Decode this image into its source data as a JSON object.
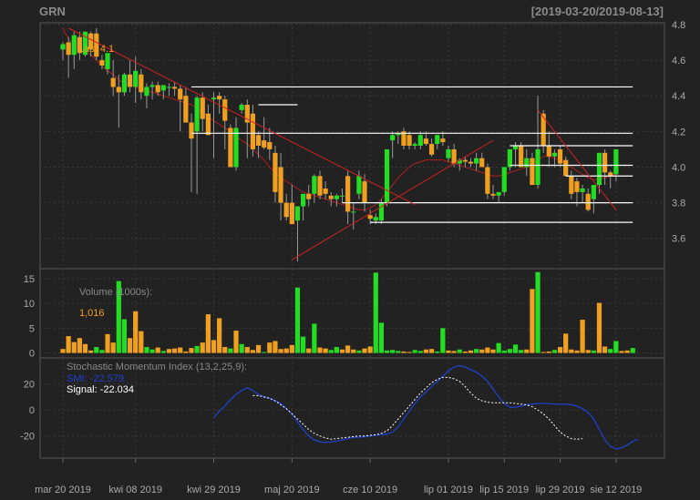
{
  "header": {
    "ticker": "GRN",
    "date_range": "[2019-03-20/2019-08-13]"
  },
  "price_panel": {
    "last_label": "Last 4.1"
  },
  "volume_panel": {
    "title": "Volume (1000s):",
    "last_value": "1,016"
  },
  "smi_panel": {
    "title": "Stochastic Momentum Index (13,2,25,9):",
    "smi_label": "SMI: -22.579",
    "signal_label": "Signal: -22.034"
  },
  "colors": {
    "background": "#222222",
    "grid": "#3a3a3a",
    "up": "#22dd22",
    "down": "#f0a020",
    "trendline": "#d42020",
    "level": "#ffffff",
    "smi": "#2040cc",
    "signal": "#ffffff",
    "axis_text": "#aaaaaa",
    "volume_title": "#888888",
    "volume_value": "#f0a020"
  },
  "chart_data": [
    {
      "type": "candlestick",
      "ticker": "GRN",
      "y_ticks": [
        3.6,
        3.8,
        4.0,
        4.2,
        4.4,
        4.6,
        4.8
      ],
      "ylim": [
        3.43,
        4.81
      ],
      "x_tick_labels": [
        "mar 20 2019",
        "kwi 08 2019",
        "kwi 29 2019",
        "maj 20 2019",
        "cze 10 2019",
        "lip 01 2019",
        "lip 15 2019",
        "lip 29 2019",
        "sie 12 2019"
      ],
      "x_tick_index": [
        0,
        13,
        27,
        41,
        55,
        69,
        79,
        89,
        99
      ],
      "candles": [
        [
          4.66,
          4.7,
          4.6,
          4.69
        ],
        [
          4.7,
          4.73,
          4.5,
          4.63
        ],
        [
          4.63,
          4.76,
          4.55,
          4.74
        ],
        [
          4.73,
          4.76,
          4.6,
          4.64
        ],
        [
          4.63,
          4.76,
          4.62,
          4.76
        ],
        [
          4.75,
          4.76,
          4.62,
          4.66
        ],
        [
          4.75,
          4.78,
          4.6,
          4.62
        ],
        [
          4.6,
          4.63,
          4.55,
          4.57
        ],
        [
          4.55,
          4.63,
          4.52,
          4.64
        ],
        [
          4.5,
          4.6,
          4.4,
          4.45
        ],
        [
          4.45,
          4.52,
          4.22,
          4.42
        ],
        [
          4.42,
          4.53,
          4.4,
          4.52
        ],
        [
          4.52,
          4.6,
          4.42,
          4.45
        ],
        [
          4.45,
          4.62,
          4.36,
          4.54
        ],
        [
          4.52,
          4.55,
          4.38,
          4.42
        ],
        [
          4.4,
          4.47,
          4.33,
          4.45
        ],
        [
          4.45,
          4.48,
          4.38,
          4.46
        ],
        [
          4.46,
          4.48,
          4.4,
          4.42
        ],
        [
          4.43,
          4.45,
          4.38,
          4.46
        ],
        [
          4.45,
          4.47,
          4.4,
          4.45
        ],
        [
          4.45,
          4.48,
          4.4,
          4.44
        ],
        [
          4.44,
          4.46,
          4.2,
          4.38
        ],
        [
          4.4,
          4.45,
          4.3,
          4.25
        ],
        [
          4.25,
          4.3,
          3.86,
          4.16
        ],
        [
          4.2,
          4.4,
          3.85,
          4.39
        ],
        [
          4.39,
          4.42,
          4.2,
          4.27
        ],
        [
          4.3,
          4.35,
          4.18,
          4.18
        ],
        [
          4.38,
          4.42,
          4.05,
          4.39
        ],
        [
          4.4,
          4.42,
          4.3,
          4.38
        ],
        [
          4.38,
          4.4,
          4.1,
          4.26
        ],
        [
          4.22,
          4.24,
          4.0,
          4.0
        ],
        [
          4.0,
          4.28,
          3.98,
          4.22
        ],
        [
          4.32,
          4.36,
          4.3,
          4.35
        ],
        [
          4.35,
          4.38,
          4.05,
          4.25
        ],
        [
          4.3,
          4.35,
          4.06,
          4.1
        ],
        [
          4.18,
          4.2,
          4.05,
          4.12
        ],
        [
          4.15,
          4.28,
          4.1,
          4.11
        ],
        [
          4.14,
          4.22,
          4.04,
          4.1
        ],
        [
          4.08,
          4.12,
          3.8,
          3.86
        ],
        [
          4.0,
          4.08,
          3.7,
          3.8
        ],
        [
          3.8,
          3.85,
          3.7,
          3.72
        ],
        [
          3.8,
          3.9,
          3.7,
          3.68
        ],
        [
          3.7,
          3.78,
          3.47,
          3.78
        ],
        [
          3.78,
          3.82,
          3.7,
          3.85
        ],
        [
          3.85,
          3.9,
          3.78,
          3.82
        ],
        [
          3.85,
          3.96,
          3.8,
          3.95
        ],
        [
          3.95,
          3.98,
          3.82,
          3.84
        ],
        [
          3.88,
          3.92,
          3.82,
          3.85
        ],
        [
          3.84,
          3.86,
          3.78,
          3.82
        ],
        [
          3.82,
          3.85,
          3.78,
          3.84
        ],
        [
          3.84,
          3.88,
          3.8,
          3.84
        ],
        [
          3.95,
          3.98,
          3.68,
          3.75
        ],
        [
          3.75,
          3.8,
          3.65,
          3.75
        ],
        [
          3.85,
          3.98,
          3.82,
          3.95
        ],
        [
          3.92,
          3.96,
          3.75,
          3.8
        ],
        [
          3.73,
          3.76,
          3.68,
          3.71
        ],
        [
          3.7,
          3.74,
          3.68,
          3.72
        ],
        [
          3.7,
          3.82,
          3.68,
          3.8
        ],
        [
          3.8,
          4.1,
          3.78,
          4.1
        ],
        [
          4.15,
          4.2,
          4.05,
          4.18
        ],
        [
          4.18,
          4.2,
          4.13,
          4.19
        ],
        [
          4.2,
          4.22,
          4.1,
          4.12
        ],
        [
          4.18,
          4.2,
          4.1,
          4.12
        ],
        [
          4.12,
          4.14,
          4.1,
          4.13
        ],
        [
          4.12,
          4.2,
          4.1,
          4.18
        ],
        [
          4.16,
          4.2,
          4.12,
          4.13
        ],
        [
          4.13,
          4.16,
          4.06,
          4.07
        ],
        [
          4.13,
          4.18,
          4.1,
          4.18
        ],
        [
          4.16,
          4.2,
          4.12,
          4.14
        ],
        [
          4.05,
          4.12,
          4.03,
          4.1
        ],
        [
          4.1,
          4.13,
          4.0,
          4.02
        ],
        [
          4.02,
          4.05,
          3.98,
          4.04
        ],
        [
          4.04,
          4.06,
          4.0,
          4.03
        ],
        [
          4.03,
          4.05,
          4.0,
          4.02
        ],
        [
          4.02,
          4.08,
          3.98,
          4.05
        ],
        [
          4.05,
          4.08,
          4.0,
          4.0
        ],
        [
          4.0,
          4.02,
          3.82,
          3.85
        ],
        [
          3.85,
          3.9,
          3.82,
          3.84
        ],
        [
          3.84,
          3.86,
          3.8,
          3.86
        ],
        [
          3.86,
          3.96,
          3.84,
          4.0
        ],
        [
          4.0,
          4.04,
          3.98,
          4.1
        ],
        [
          4.1,
          4.14,
          4.0,
          4.12
        ],
        [
          4.12,
          4.14,
          4.0,
          4.0
        ],
        [
          4.0,
          4.1,
          3.95,
          4.05
        ],
        [
          4.05,
          4.08,
          3.92,
          3.9
        ],
        [
          3.9,
          4.4,
          3.88,
          4.1
        ],
        [
          4.3,
          4.32,
          4.08,
          4.12
        ],
        [
          4.12,
          4.2,
          4.0,
          4.06
        ],
        [
          4.06,
          4.1,
          4.0,
          4.08
        ],
        [
          4.1,
          4.12,
          4.0,
          4.02
        ],
        [
          4.04,
          4.06,
          3.95,
          3.95
        ],
        [
          3.95,
          3.98,
          3.82,
          3.85
        ],
        [
          3.92,
          3.94,
          3.78,
          3.86
        ],
        [
          3.86,
          3.9,
          3.8,
          3.88
        ],
        [
          3.85,
          3.88,
          3.75,
          3.76
        ],
        [
          3.82,
          3.9,
          3.74,
          3.9
        ],
        [
          3.9,
          4.08,
          3.85,
          4.08
        ],
        [
          4.08,
          4.1,
          3.9,
          3.97
        ],
        [
          3.97,
          3.98,
          3.88,
          3.95
        ],
        [
          3.96,
          4.1,
          3.92,
          4.1
        ]
      ],
      "moving_average": [
        4.78,
        4.72,
        4.69,
        4.67,
        4.65,
        4.63,
        4.6,
        4.57,
        4.54,
        4.52,
        4.49,
        4.47,
        4.46,
        4.45,
        4.44,
        4.43,
        4.42,
        4.41,
        4.4,
        4.39,
        4.38,
        4.37,
        4.36,
        4.35,
        4.33,
        4.31,
        4.28,
        4.26,
        4.24,
        4.22,
        4.2,
        4.17,
        4.15,
        4.13,
        4.1,
        4.07,
        4.04,
        4.0,
        3.97,
        3.94,
        3.92,
        3.9,
        3.88,
        3.86,
        3.85,
        3.84,
        3.83,
        3.82,
        3.81,
        3.8,
        3.79,
        3.78,
        3.77,
        3.76,
        3.76,
        3.77,
        3.79,
        3.82,
        3.86,
        3.9,
        3.94,
        3.97,
        4.0,
        4.02,
        4.03,
        4.04,
        4.04,
        4.04,
        4.04,
        4.03,
        4.02,
        4.01,
        4.0,
        3.99,
        3.98,
        3.97,
        3.96,
        3.95,
        3.95,
        3.96,
        3.97,
        3.98,
        3.99,
        4.0,
        4.02,
        4.04,
        4.06,
        4.06,
        4.05,
        4.04,
        4.02,
        4.0,
        3.98,
        3.96,
        3.94,
        3.93,
        3.93,
        3.94,
        3.95,
        3.96
      ],
      "trendlines": [
        {
          "from": [
            1,
            4.78
          ],
          "to": [
            63,
            3.79
          ]
        },
        {
          "from": [
            41,
            3.48
          ],
          "to": [
            77,
            4.15
          ]
        },
        {
          "from": [
            85,
            4.32
          ],
          "to": [
            99,
            3.76
          ]
        }
      ],
      "levels": [
        {
          "from": 23,
          "to": 102,
          "value": 4.45
        },
        {
          "from": 35,
          "to": 42,
          "value": 4.35
        },
        {
          "from": 23,
          "to": 102,
          "value": 4.19
        },
        {
          "from": 80,
          "to": 102,
          "value": 4.12
        },
        {
          "from": 80,
          "to": 102,
          "value": 4.01
        },
        {
          "from": 90,
          "to": 102,
          "value": 3.95
        },
        {
          "from": 50,
          "to": 102,
          "value": 3.8
        },
        {
          "from": 55,
          "to": 102,
          "value": 3.69
        }
      ]
    },
    {
      "type": "bar",
      "name": "Volume (1000s)",
      "y_ticks": [
        0,
        5,
        10,
        15
      ],
      "ylim": [
        -1,
        17
      ],
      "values": [
        0.8,
        3.4,
        2.2,
        3.0,
        1.8,
        0.5,
        1.2,
        0.6,
        3.8,
        2.1,
        14.5,
        6.8,
        3.0,
        8.4,
        4.4,
        1.2,
        0.7,
        1.1,
        0.4,
        0.8,
        0.9,
        1.1,
        0.3,
        1.0,
        1.4,
        2.1,
        7.8,
        2.6,
        7.0,
        1.2,
        0.9,
        4.5,
        1.8,
        1.2,
        0.6,
        1.6,
        0.2,
        2.1,
        2.4,
        0.8,
        0.9,
        1.6,
        13.2,
        3.3,
        0.9,
        5.9,
        1.1,
        0.9,
        0.6,
        1.2,
        0.7,
        1.5,
        0.7,
        0.5,
        0.9,
        1.3,
        16.2,
        6.1,
        0.5,
        0.6,
        0.4,
        0.3,
        0.2,
        0.6,
        0.4,
        0.7,
        0.8,
        0.3,
        5.0,
        0.5,
        0.4,
        0.7,
        0.3,
        0.5,
        0.8,
        0.7,
        1.1,
        0.7,
        2.0,
        0.5,
        0.8,
        1.7,
        0.6,
        0.7,
        12.9,
        16.3,
        0.2,
        0.3,
        0.6,
        1.2,
        3.9,
        0.7,
        0.5,
        6.7,
        0.6,
        0.5,
        10.1,
        1.3,
        0.8,
        2.4,
        0.4,
        0.5,
        1.0
      ],
      "ups": [
        0,
        0,
        0,
        0,
        0,
        0,
        1,
        1,
        0,
        0,
        1,
        1,
        0,
        0,
        0,
        1,
        1,
        0,
        1,
        0,
        0,
        0,
        0,
        0,
        1,
        0,
        0,
        0,
        0,
        0,
        1,
        0,
        1,
        0,
        0,
        0,
        1,
        0,
        0,
        0,
        0,
        0,
        1,
        1,
        0,
        1,
        0,
        0,
        1,
        1,
        0,
        0,
        0,
        1,
        0,
        0,
        1,
        1,
        1,
        1,
        1,
        0,
        0,
        1,
        1,
        0,
        0,
        1,
        1,
        0,
        0,
        1,
        0,
        0,
        1,
        0,
        0,
        0,
        1,
        1,
        1,
        1,
        1,
        0,
        0,
        1,
        0,
        0,
        1,
        0,
        0,
        0,
        0,
        0,
        0,
        1,
        0,
        0,
        1,
        1,
        0,
        0,
        1
      ]
    },
    {
      "type": "line",
      "name": "Stochastic Momentum Index (13,2,25,9)",
      "y_ticks": [
        -20,
        0,
        20
      ],
      "ylim": [
        -37,
        40
      ],
      "series": [
        {
          "name": "SMI",
          "start_index": 27,
          "values": [
            -6,
            -1,
            3,
            8,
            12,
            15,
            17,
            15,
            12,
            10,
            9,
            7,
            5,
            1,
            -3,
            -9,
            -15,
            -20,
            -23,
            -24.5,
            -25,
            -24.5,
            -24,
            -23,
            -22,
            -21,
            -21,
            -20.5,
            -20,
            -19.5,
            -19,
            -18.5,
            -17,
            -13,
            -7,
            -1,
            5,
            10,
            14,
            18,
            22,
            26,
            30,
            33,
            34,
            33,
            31,
            29,
            26,
            22,
            16,
            10,
            5,
            2,
            2,
            3,
            4,
            4.5,
            5,
            5,
            5,
            4.5,
            4.5,
            4.5,
            4,
            3,
            1,
            -2,
            -7,
            -15,
            -23,
            -28,
            -30,
            -29,
            -27,
            -24,
            -22.6
          ]
        },
        {
          "name": "Signal",
          "start_index": 34,
          "values": [
            11,
            11,
            10,
            9,
            7,
            4,
            1,
            -3,
            -7,
            -11,
            -15,
            -18,
            -20,
            -21.5,
            -22.5,
            -22,
            -21.5,
            -21,
            -20.5,
            -20,
            -20,
            -19.5,
            -19,
            -18,
            -16,
            -12,
            -7,
            -2,
            3,
            8,
            13,
            17,
            21,
            23.5,
            25,
            25,
            24,
            22,
            18,
            13,
            9,
            7,
            6,
            5.5,
            5.5,
            5.5,
            5.5,
            5,
            4.5,
            4,
            2.5,
            0,
            -3,
            -7,
            -12,
            -17,
            -20,
            -22,
            -22.5,
            -22
          ]
        }
      ]
    }
  ]
}
